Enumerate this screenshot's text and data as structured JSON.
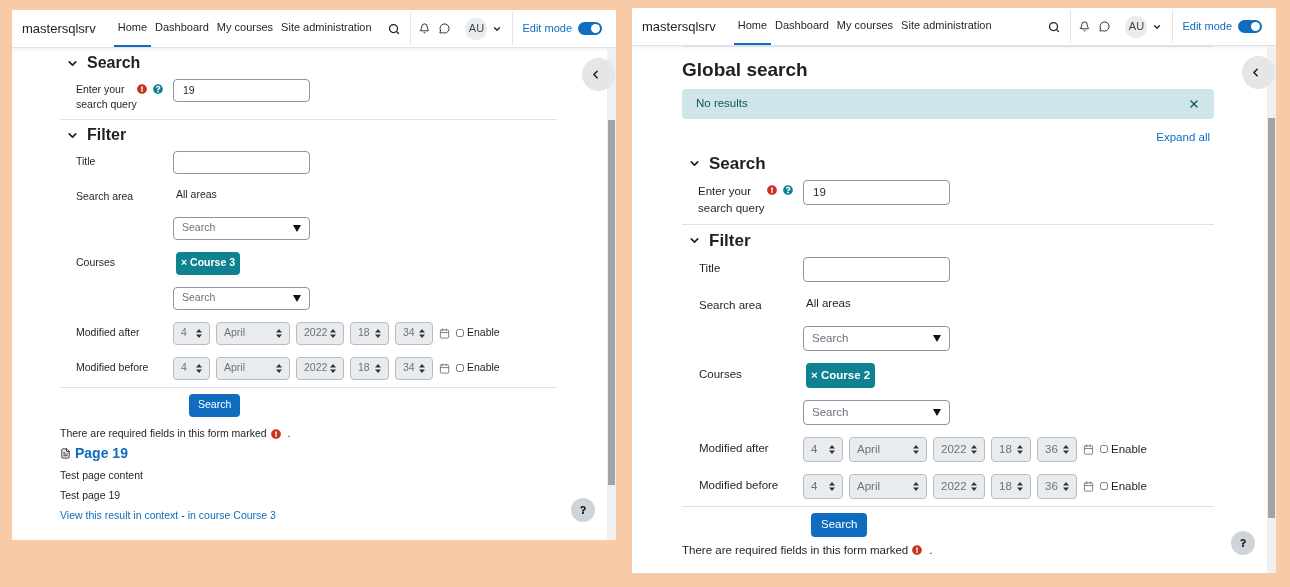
{
  "panels": [
    {
      "brand": "mastersqlsrv",
      "nav": [
        {
          "label": "Home",
          "selected": true
        },
        {
          "label": "Dashboard",
          "selected": false
        },
        {
          "label": "My courses",
          "selected": false
        },
        {
          "label": "Site administration",
          "selected": false
        }
      ],
      "avatar": "AU",
      "edit_mode": {
        "label": "Edit mode",
        "on": true
      },
      "sections": [
        {
          "title": "Search",
          "expanded": true,
          "fields": [
            {
              "kind": "query",
              "label": "Enter your search query",
              "value": "19"
            }
          ]
        },
        {
          "title": "Filter",
          "expanded": true,
          "fields": [
            {
              "kind": "text",
              "label": "Title"
            },
            {
              "kind": "static",
              "label": "Search area",
              "value": "All areas"
            },
            {
              "kind": "autocomplete",
              "placeholder": "Search"
            },
            {
              "kind": "tags",
              "label": "Courses",
              "tags": [
                "× Course 3"
              ]
            },
            {
              "kind": "autocomplete",
              "placeholder": "Search"
            },
            {
              "kind": "date",
              "label": "Modified after",
              "parts": [
                "4",
                "April",
                "2022",
                "18",
                "34"
              ],
              "enable": {
                "label": "Enable",
                "checked": false
              }
            },
            {
              "kind": "date",
              "label": "Modified before",
              "parts": [
                "4",
                "April",
                "2022",
                "18",
                "34"
              ],
              "enable": {
                "label": "Enable",
                "checked": false
              }
            }
          ]
        }
      ],
      "submit": "Search",
      "required_note": "There are required fields in this form marked",
      "required_end": ".",
      "results": [
        {
          "title": "Page 19",
          "lines": [
            "Test page content",
            "Test page 19"
          ],
          "link": "View this result in context",
          "separator": "-",
          "course_link": "in course Course 3"
        }
      ]
    },
    {
      "brand": "mastersqlsrv",
      "nav": [
        {
          "label": "Home",
          "selected": true
        },
        {
          "label": "Dashboard",
          "selected": false
        },
        {
          "label": "My courses",
          "selected": false
        },
        {
          "label": "Site administration",
          "selected": false
        }
      ],
      "avatar": "AU",
      "edit_mode": {
        "label": "Edit mode",
        "on": true
      },
      "title": "Global search",
      "alert": {
        "text": "No results"
      },
      "expand_all": "Expand all",
      "sections": [
        {
          "title": "Search",
          "expanded": true,
          "fields": [
            {
              "kind": "query",
              "label": "Enter your search query",
              "value": "19"
            }
          ]
        },
        {
          "title": "Filter",
          "expanded": true,
          "fields": [
            {
              "kind": "text",
              "label": "Title"
            },
            {
              "kind": "static",
              "label": "Search area",
              "value": "All areas"
            },
            {
              "kind": "autocomplete",
              "placeholder": "Search"
            },
            {
              "kind": "tags",
              "label": "Courses",
              "tags": [
                "× Course 2"
              ]
            },
            {
              "kind": "autocomplete",
              "placeholder": "Search"
            },
            {
              "kind": "date",
              "label": "Modified after",
              "parts": [
                "4",
                "April",
                "2022",
                "18",
                "36"
              ],
              "enable": {
                "label": "Enable",
                "checked": false
              }
            },
            {
              "kind": "date",
              "label": "Modified before",
              "parts": [
                "4",
                "April",
                "2022",
                "18",
                "36"
              ],
              "enable": {
                "label": "Enable",
                "checked": false
              }
            }
          ]
        }
      ],
      "submit": "Search",
      "required_note": "There are required fields in this form marked",
      "required_end": "."
    }
  ]
}
